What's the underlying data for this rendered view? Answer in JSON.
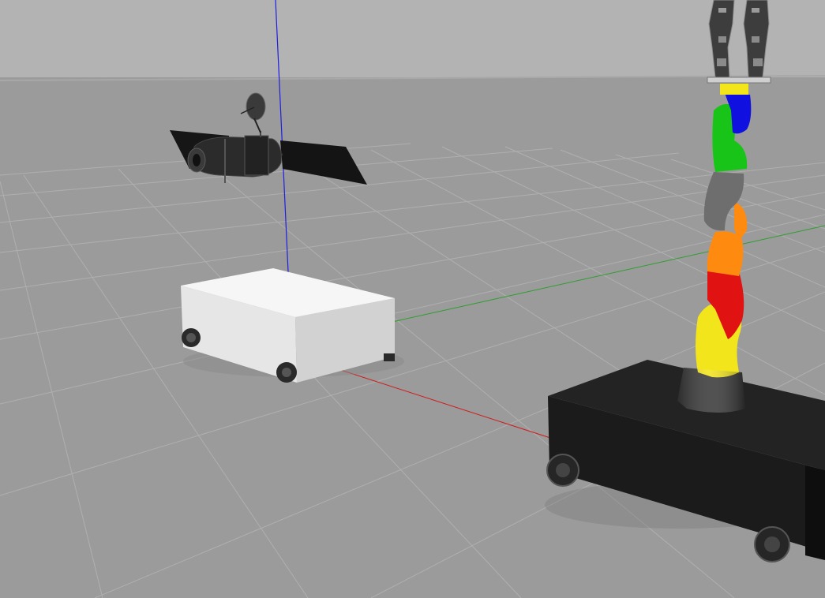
{
  "scene": {
    "kind": "3d-simulation-viewport",
    "sky_color": "#b3b3b3",
    "ground_color": "#9b9b9b",
    "grid_color": "#b0b0b0",
    "axis_colors": {
      "x": "#d11b1b",
      "y": "#2f9e2f",
      "z": "#1f1fe0"
    },
    "objects": [
      {
        "name": "satellite",
        "body_color": "#2a2a2a",
        "panel_color": "#111111"
      },
      {
        "name": "white-mobile-base",
        "top_color": "#f4f4f4",
        "front_color": "#d8d8d8",
        "side_color": "#eaeaea"
      },
      {
        "name": "black-mobile-base",
        "top_color": "#1f1f1f",
        "front_color": "#0f0f0f",
        "side_color": "#161616"
      },
      {
        "name": "robot-arm",
        "link_colors": [
          "#3a3a3a",
          "#f3e51c",
          "#e11212",
          "#ff8a10",
          "#6e6e6e",
          "#18c418",
          "#1010e0"
        ]
      },
      {
        "name": "gripper",
        "color": "#3d3d3d"
      }
    ]
  }
}
